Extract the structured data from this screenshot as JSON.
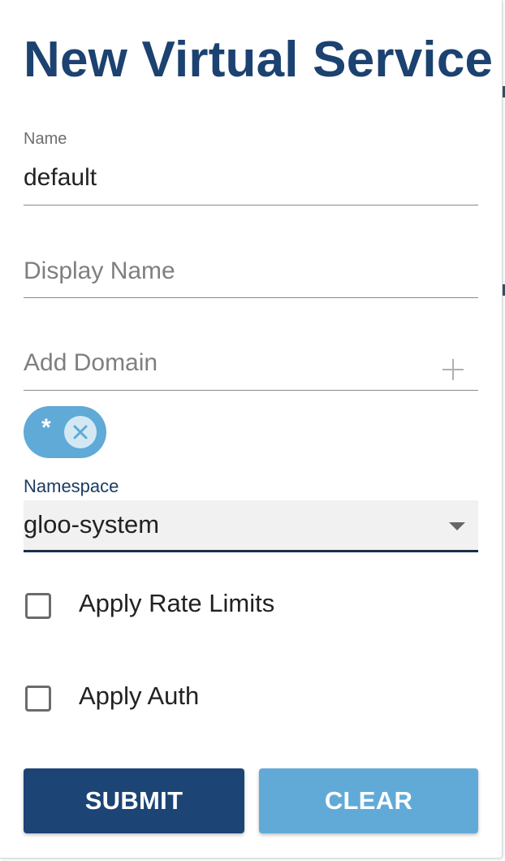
{
  "form": {
    "title": "New Virtual Service",
    "name_field": {
      "label": "Name",
      "value": "default"
    },
    "display_name_field": {
      "placeholder": "Display Name"
    },
    "domain_field": {
      "placeholder": "Add Domain",
      "add_icon": "plus-icon"
    },
    "domains": [
      {
        "label": "*",
        "remove_icon": "close-icon"
      }
    ],
    "namespace_field": {
      "label": "Namespace",
      "value": "gloo-system",
      "icon": "caret-down-icon"
    },
    "checkboxes": [
      {
        "label": "Apply Rate Limits",
        "checked": false
      },
      {
        "label": "Apply Auth",
        "checked": false
      }
    ],
    "buttons": {
      "submit_label": "SUBMIT",
      "clear_label": "CLEAR"
    }
  },
  "colors": {
    "title": "#1b4270",
    "submit_button": "#1c4474",
    "clear_button": "#61aad8",
    "chip": "#5faad6",
    "namespace_label": "#1b3c62"
  }
}
